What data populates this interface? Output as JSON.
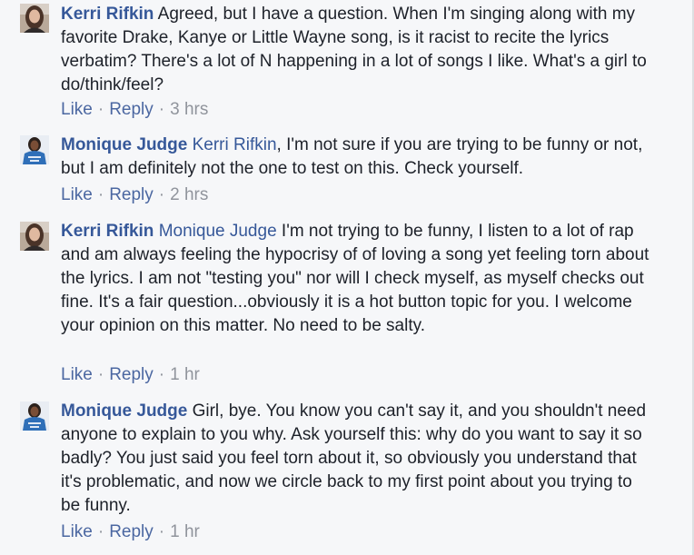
{
  "comments": [
    {
      "author": "Kerri Rifkin",
      "mention": "",
      "text": "Agreed, but I have a question. When I'm singing along with my favorite Drake, Kanye or Little Wayne song, is it racist to recite the lyrics verbatim? There's a lot of N happening in a lot of songs I like. What's a girl to do/think/feel?",
      "like": "Like",
      "reply": "Reply",
      "separator": "·",
      "time": "3 hrs"
    },
    {
      "author": "Monique Judge",
      "mention": "Kerri Rifkin",
      "text": ", I'm not sure if you are trying to be funny or not, but I am definitely not the one to test on this. Check yourself.",
      "like": "Like",
      "reply": "Reply",
      "separator": "·",
      "time": "2 hrs"
    },
    {
      "author": "Kerri Rifkin",
      "mention": "Monique Judge",
      "text": "I'm not trying to be funny, I listen to a lot of rap and am always feeling the hypocrisy of of loving a song yet feeling torn about the lyrics. I am not \"testing you\" nor will I check myself, as myself checks out fine. It's a fair question...obviously it is a hot button topic for you. I welcome your opinion on this matter. No need to be salty.",
      "like": "Like",
      "reply": "Reply",
      "separator": "·",
      "time": "1 hr"
    },
    {
      "author": "Monique Judge",
      "mention": "",
      "text": "Girl, bye. You know you can't say it, and you shouldn't need anyone to explain to you why. Ask yourself this: why do you want to say it so badly? You just said you feel torn about it, so obviously you understand that it's problematic, and now we circle back to my first point about you trying to be funny.",
      "like": "Like",
      "reply": "Reply",
      "separator": "·",
      "time": "1 hr"
    }
  ],
  "colors": {
    "background": "#f6f7f9",
    "link": "#365899",
    "action_link": "#4b67a1",
    "meta": "#90949c",
    "text": "#1d2129"
  },
  "icons": {
    "kerri_avatar": "profile-photo-woman-dark-hair",
    "monique_avatar": "profile-photo-woman-blue-shirt"
  }
}
